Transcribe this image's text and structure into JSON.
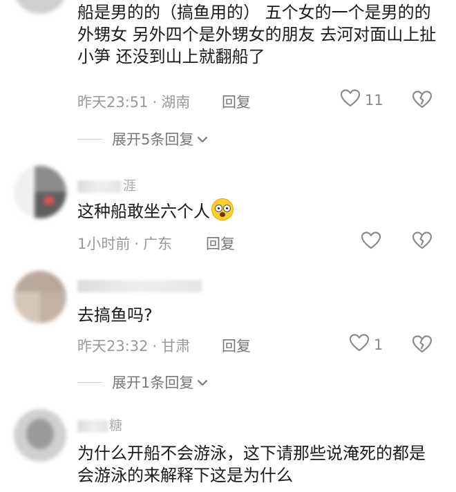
{
  "comments": [
    {
      "text": "船是男的的（搞鱼用的） 五个女的一个是男的的外甥女 另外四个是外甥女的朋友 去河对面山上扯小笋 还没到山上就翻船了",
      "time": "昨天23:51",
      "dot": "·",
      "location": "湖南",
      "reply_label": "回复",
      "like_count": "11"
    },
    {
      "username_fragment": "涯",
      "text": "这种船敢坐六个人",
      "emoji": "flushed-face",
      "time": "1小时前",
      "dot": "·",
      "location": "广东",
      "reply_label": "回复",
      "like_count": ""
    },
    {
      "username_fragment": "",
      "text": "去搞鱼吗?",
      "time": "昨天23:32",
      "dot": "·",
      "location": "甘肃",
      "reply_label": "回复",
      "like_count": "1"
    },
    {
      "username_fragment": "糖",
      "text": "为什么开船不会游泳，这下请那些说淹死的都是会游泳的来解释下这是为什么"
    }
  ],
  "expand_replies": [
    {
      "label": "展开5条回复"
    },
    {
      "label": "展开1条回复"
    }
  ],
  "icons": {
    "like": "heart-outline-icon",
    "dislike": "broken-heart-icon",
    "expand": "chevron-down-icon"
  },
  "colors": {
    "text": "#1a1a1a",
    "meta": "#999999",
    "icon": "#8a8a8a"
  }
}
